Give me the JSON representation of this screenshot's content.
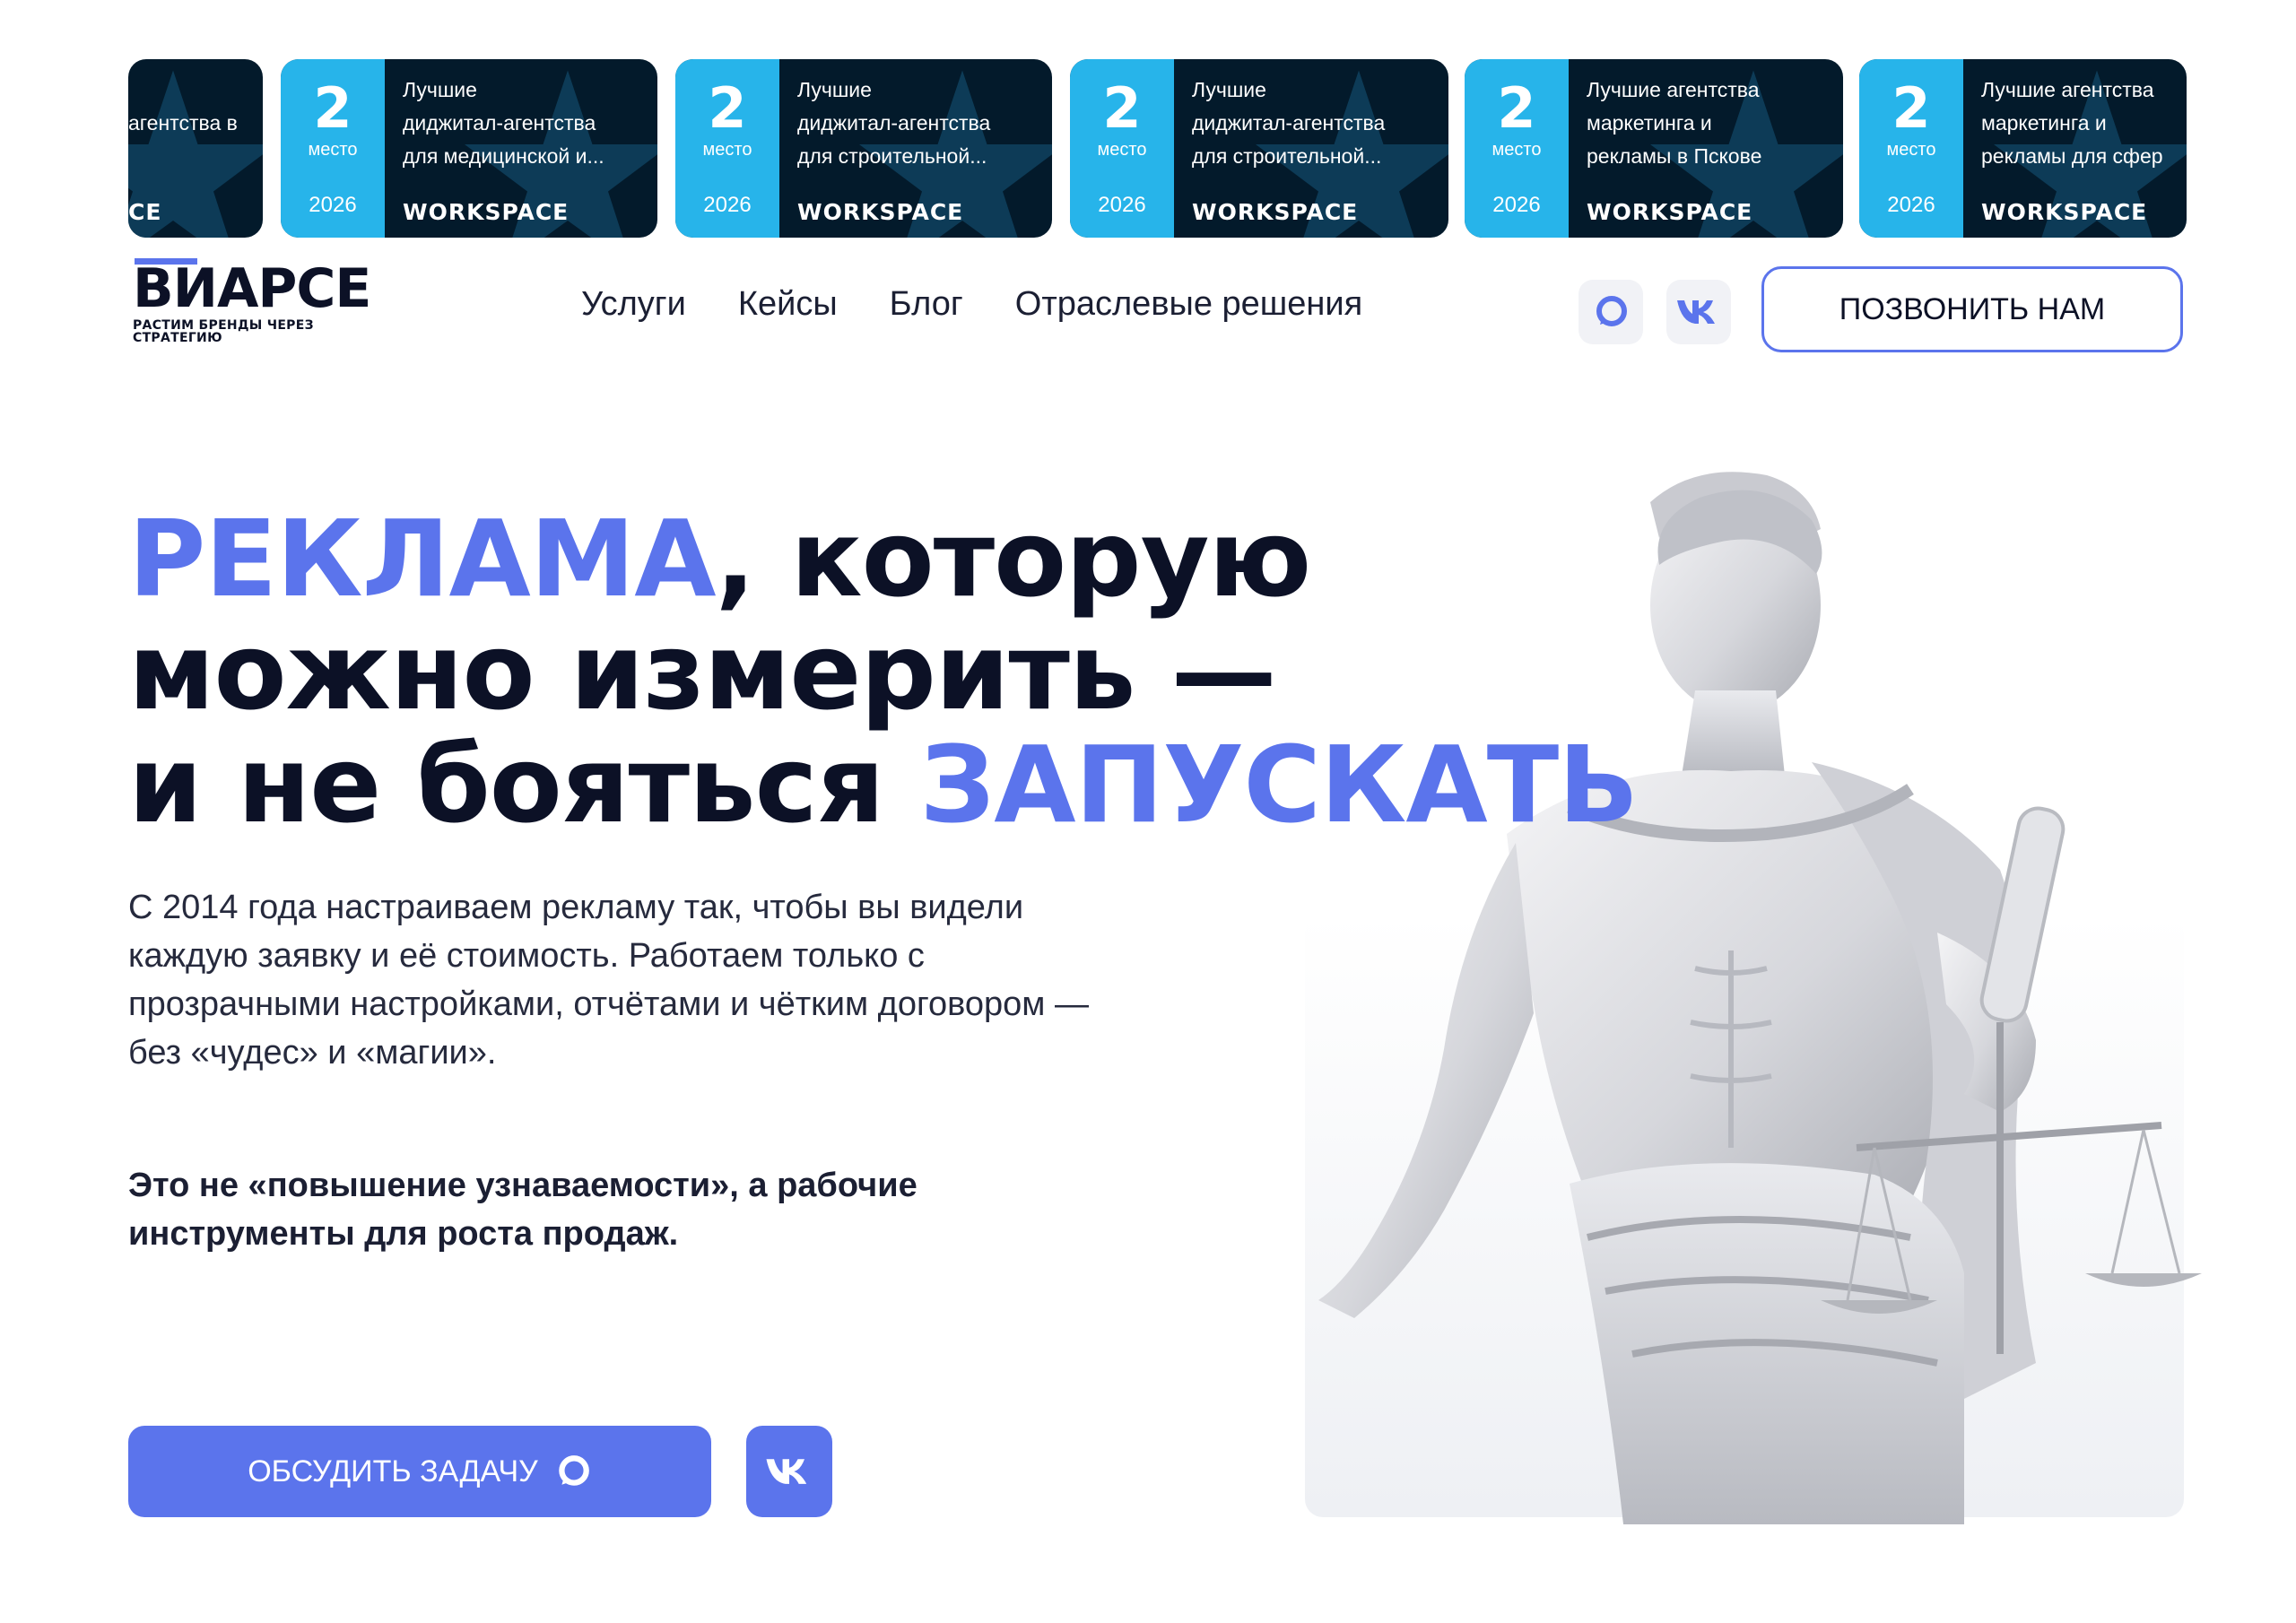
{
  "awards": {
    "partial": {
      "desc": "агентства в",
      "brand": "CE"
    },
    "items": [
      {
        "place": "2",
        "place_label": "место",
        "year": "2026",
        "line1": "Лучшие",
        "line2": "диджитал-агентства",
        "line3": "для медицинской и...",
        "brand": "WORKSPACE"
      },
      {
        "place": "2",
        "place_label": "место",
        "year": "2026",
        "line1": "Лучшие",
        "line2": "диджитал-агентства",
        "line3": "для строительной...",
        "brand": "WORKSPACE"
      },
      {
        "place": "2",
        "place_label": "место",
        "year": "2026",
        "line1": "Лучшие",
        "line2": "диджитал-агентства",
        "line3": "для строительной...",
        "brand": "WORKSPACE"
      },
      {
        "place": "2",
        "place_label": "место",
        "year": "2026",
        "line1": "Лучшие агентства",
        "line2": "маркетинга и",
        "line3": "рекламы в Пскове",
        "brand": "WORKSPACE"
      },
      {
        "place": "2",
        "place_label": "место",
        "year": "2026",
        "line1": "Лучшие агентства",
        "line2": "маркетинга и",
        "line3": "рекламы для сфер",
        "brand": "WORKSPACE"
      }
    ]
  },
  "header": {
    "logo": "ВИАРСЕ",
    "tagline": "РАСТИМ БРЕНДЫ ЧЕРЕЗ СТРАТЕГИЮ",
    "nav": [
      "Услуги",
      "Кейсы",
      "Блог",
      "Отраслевые решения"
    ],
    "call_button": "ПОЗВОНИТЬ НАМ",
    "social_icons": [
      "max-messenger-icon",
      "vk-icon"
    ]
  },
  "hero": {
    "title_accent_1": "РЕКЛАМА",
    "title_rest_1": ", которую",
    "title_line_2": "можно измерить —",
    "title_line_3_start": "и не бояться ",
    "title_accent_2": "ЗАПУСКАТЬ",
    "lead": "С 2014 года настраиваем рекламу так, чтобы вы видели каждую заявку и её стоимость. Работаем только с прозрачными настройками, отчётами и чётким договором — без «чудес» и «магии».",
    "lead_strong": "Это не «повышение узнаваемости», а рабочие инструменты для роста продаж.",
    "cta_label": "ОБСУДИТЬ ЗАДАЧУ"
  },
  "colors": {
    "accent": "#5b74ec",
    "badge_blue": "#27b4ea",
    "badge_dark": "#031a2b",
    "text_dark": "#0c1126"
  }
}
